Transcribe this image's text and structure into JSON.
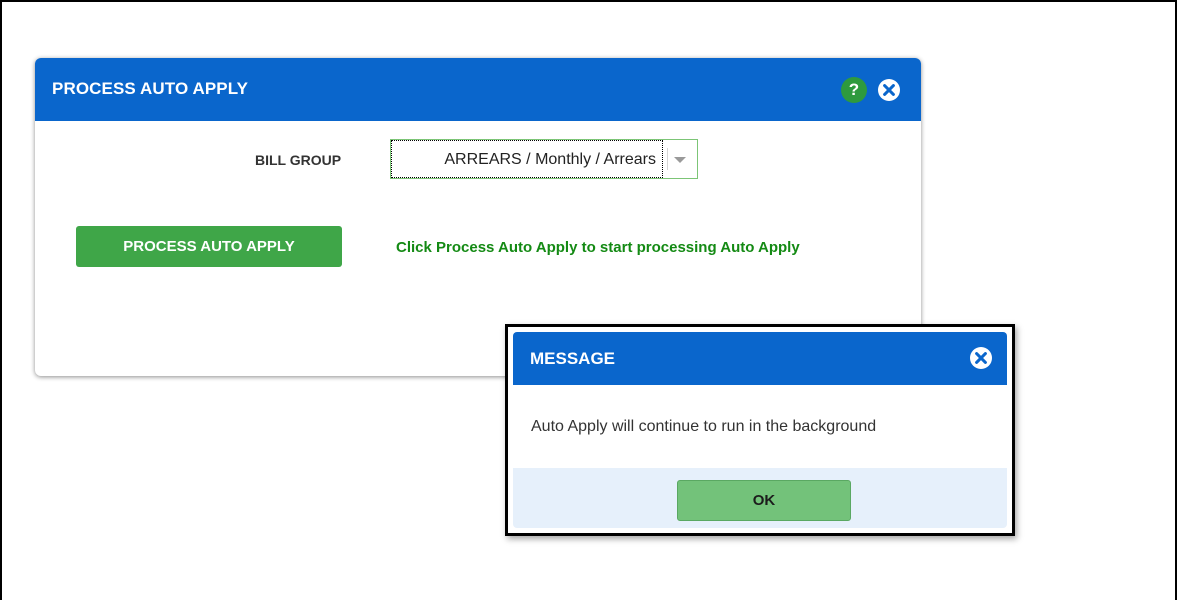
{
  "main_dialog": {
    "title": "PROCESS AUTO APPLY",
    "help_icon_glyph": "?",
    "bill_group_label": "BILL GROUP",
    "bill_group_value": "ARREARS / Monthly / Arrears",
    "process_button_label": "PROCESS AUTO APPLY",
    "hint": "Click Process Auto Apply to start processing Auto Apply"
  },
  "message_dialog": {
    "title": "MESSAGE",
    "text": "Auto Apply will continue to run in the background",
    "ok_label": "OK"
  },
  "icons": {
    "help": "help-icon",
    "close": "close-icon",
    "dropdown": "chevron-down-icon"
  },
  "colors": {
    "header_blue": "#0a66cc",
    "primary_green": "#3fa648",
    "hint_green": "#148a14",
    "ok_green": "#73c27a",
    "footer_blue": "#e6f0fb"
  }
}
